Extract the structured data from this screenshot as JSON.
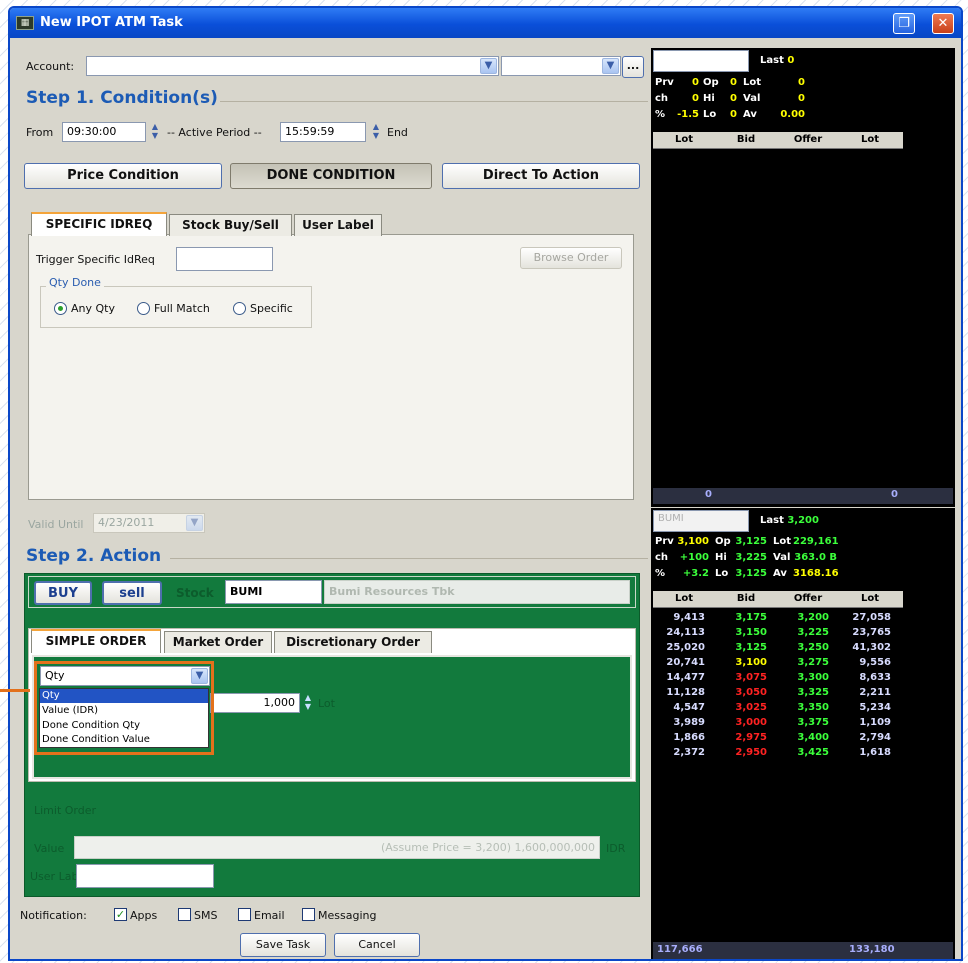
{
  "window": {
    "title": "New IPOT ATM Task",
    "icon": "app-icon",
    "close_glyph": "✕",
    "restore_glyph": "❐"
  },
  "account": {
    "label": "Account:",
    "value": "",
    "value2": "",
    "browse_label": "..."
  },
  "step1": {
    "title": "Step 1. Condition(s)",
    "from_label": "From",
    "from_value": "09:30:00",
    "active_period_label": "-- Active Period --",
    "end_value": "15:59:59",
    "end_label": "End",
    "buttons": [
      "Price Condition",
      "DONE CONDITION",
      "Direct To Action"
    ],
    "tabs": [
      "SPECIFIC IDREQ",
      "Stock Buy/Sell",
      "User Label"
    ],
    "trigger_label": "Trigger Specific IdReq",
    "trigger_value": "",
    "browse_order_label": "Browse Order",
    "qty_done_label": "Qty Done",
    "radios": [
      {
        "label": "Any Qty",
        "selected": true
      },
      {
        "label": "Full Match",
        "selected": false
      },
      {
        "label": "Specific",
        "selected": false
      }
    ],
    "valid_until_label": "Valid Until",
    "valid_until_value": "4/23/2011"
  },
  "step2": {
    "title": "Step 2. Action",
    "buy_label": "BUY",
    "sell_label": "sell",
    "stock_label": "Stock",
    "stock_code": "BUMI",
    "stock_name": "Bumi Resources Tbk",
    "tabs": [
      "SIMPLE ORDER",
      "Market Order",
      "Discretionary Order"
    ],
    "qty_type_selected": "Qty",
    "qty_type_options": [
      "Qty",
      "Value (IDR)",
      "Done Condition Qty",
      "Done Condition Value"
    ],
    "qty_value": "1,000",
    "qty_unit": "Lot",
    "limit_order_label": "Limit Order",
    "value_label": "Value",
    "value_text": "(Assume Price = 3,200) 1,600,000,000",
    "value_unit": "IDR",
    "user_label_label": "User Label",
    "user_label_value": ""
  },
  "notification": {
    "label": "Notification:",
    "options": [
      {
        "label": "Apps",
        "checked": true
      },
      {
        "label": "SMS",
        "checked": false
      },
      {
        "label": "Email",
        "checked": false
      },
      {
        "label": "Messaging",
        "checked": false
      }
    ]
  },
  "footer": {
    "save_label": "Save Task",
    "cancel_label": "Cancel"
  },
  "quote_top": {
    "stock": "",
    "last_label": "Last",
    "last_value": "0",
    "rows": [
      [
        "Prv",
        "0",
        "Op",
        "0",
        "Lot",
        "0"
      ],
      [
        "ch",
        "0",
        "Hi",
        "0",
        "Val",
        "0"
      ],
      [
        "%",
        "-1.5",
        "Lo",
        "0",
        "Av",
        "0.00"
      ]
    ],
    "columns": [
      "Lot",
      "Bid",
      "Offer",
      "Lot"
    ],
    "total_left": "0",
    "total_right": "0"
  },
  "quote_bottom": {
    "stock": "BUMI",
    "last_label": "Last",
    "last_value": "3,200",
    "rows": [
      [
        "Prv",
        "3,100",
        "Op",
        "3,125",
        "Lot",
        "229,161"
      ],
      [
        "ch",
        "+100",
        "Hi",
        "3,225",
        "Val",
        "363.0 B"
      ],
      [
        "%",
        "+3.2",
        "Lo",
        "3,125",
        "Av",
        "3168.16"
      ]
    ],
    "columns": [
      "Lot",
      "Bid",
      "Offer",
      "Lot"
    ],
    "book": [
      [
        "9,413",
        "3,175",
        "3,200",
        "27,058"
      ],
      [
        "24,113",
        "3,150",
        "3,225",
        "23,765"
      ],
      [
        "25,020",
        "3,125",
        "3,250",
        "41,302"
      ],
      [
        "20,741",
        "3,100",
        "3,275",
        "9,556"
      ],
      [
        "14,477",
        "3,075",
        "3,300",
        "8,633"
      ],
      [
        "11,128",
        "3,050",
        "3,325",
        "2,211"
      ],
      [
        "4,547",
        "3,025",
        "3,350",
        "5,234"
      ],
      [
        "3,989",
        "3,000",
        "3,375",
        "1,109"
      ],
      [
        "1,866",
        "2,975",
        "3,400",
        "2,794"
      ],
      [
        "2,372",
        "2,950",
        "3,425",
        "1,618"
      ]
    ],
    "total_left": "117,666",
    "total_right": "133,180"
  },
  "colors": {
    "accent": "#1c5bb5",
    "action_panel": "#127a3d",
    "highlight_border": "#e3711b",
    "titlebar": "#0a4fd9"
  }
}
